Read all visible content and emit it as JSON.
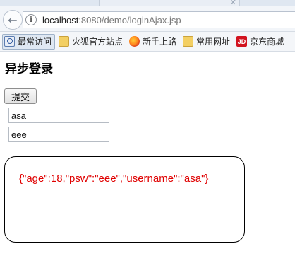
{
  "browser": {
    "url_host": "localhost",
    "url_rest": ":8080/demo/loginAjax.jsp"
  },
  "bookmarks": [
    {
      "label": "最常访问",
      "icon": "search-icon"
    },
    {
      "label": "火狐官方站点",
      "icon": "folder-icon"
    },
    {
      "label": "新手上路",
      "icon": "firefox-icon"
    },
    {
      "label": "常用网址",
      "icon": "folder-icon"
    },
    {
      "label": "京东商城",
      "icon": "jd-icon",
      "icon_text": "JD"
    }
  ],
  "page": {
    "title": "异步登录",
    "submit_label": "提交",
    "username_value": "asa",
    "password_value": "eee",
    "result_text": "{\"age\":18,\"psw\":\"eee\",\"username\":\"asa\"}",
    "result_color": "#e00000"
  }
}
